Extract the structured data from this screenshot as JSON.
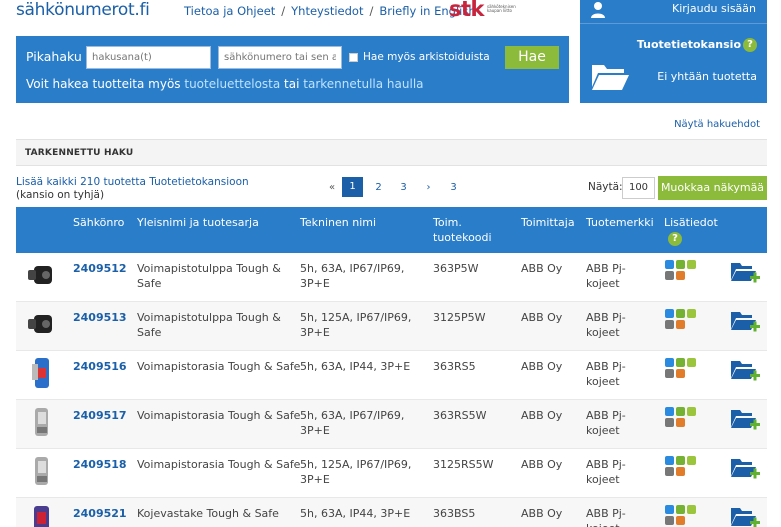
{
  "header": {
    "logo": "sähkönumerot.fi",
    "nav": [
      "Tietoa ja Ohjeet",
      "Yhteystiedot",
      "Briefly in English"
    ],
    "nav_sep": "/",
    "stk_logo": "stk",
    "stk_sub": "sähköteknisen kaupan liitto"
  },
  "search": {
    "label": "Pikahaku",
    "keyword_placeholder": "hakusana(t)",
    "number_placeholder": "sähkönumero tai sen alku",
    "archive_label": "Hae myös arkistoiduista",
    "button": "Hae",
    "hint_prefix": "Voit hakea tuotteita myös",
    "hint_link1": "tuoteluettelosta",
    "hint_middle": "tai",
    "hint_link2": "tarkennetulla haulla"
  },
  "account": {
    "login": "Kirjaudu sisään",
    "folder_title": "Tuotetietokansio",
    "help": "?",
    "folder_empty": "Ei yhtään tuotetta"
  },
  "show_conditions": "Näytä hakuehdot",
  "advanced_search_title": "TARKENNETTU HAKU",
  "add_all": "Lisää kaikki 210 tuotetta Tuotetietokansioon",
  "folder_status": "(kansio on tyhjä)",
  "pagination": {
    "first": "«",
    "prev": "‹",
    "pages": [
      "1",
      "2",
      "3"
    ],
    "next": "›",
    "last": "3",
    "active": "1"
  },
  "display": {
    "label": "Näytä:",
    "value": "100",
    "edit_button": "Muokkaa näkymää"
  },
  "table": {
    "headers": {
      "number": "Sähkönro",
      "name": "Yleisnimi ja tuotesarja",
      "tech": "Tekninen nimi",
      "code_line1": "Toim.",
      "code_line2": "tuotekoodi",
      "supplier": "Toimittaja",
      "brand": "Tuotemerkki",
      "info": "Lisätiedot",
      "help": "?"
    },
    "rows": [
      {
        "number": "2409512",
        "name1": "Voimapistotulppa Tough &",
        "name2": "Safe",
        "tech1": "5h, 63A, IP67/IP69,",
        "tech2": "3P+E",
        "code": "363P5W",
        "supplier": "ABB Oy",
        "brand1": "ABB Pj-",
        "brand2": "kojeet",
        "thumb": "plug-black"
      },
      {
        "number": "2409513",
        "name1": "Voimapistotulppa Tough &",
        "name2": "Safe",
        "tech1": "5h, 125A, IP67/IP69,",
        "tech2": "3P+E",
        "code": "3125P5W",
        "supplier": "ABB Oy",
        "brand1": "ABB Pj-",
        "brand2": "kojeet",
        "thumb": "plug-black"
      },
      {
        "number": "2409516",
        "name1": "Voimapistorasia Tough & Safe",
        "name2": "",
        "tech1": "5h, 63A, IP44, 3P+E",
        "tech2": "",
        "code": "363RS5",
        "supplier": "ABB Oy",
        "brand1": "ABB Pj-",
        "brand2": "kojeet",
        "thumb": "socket-blue"
      },
      {
        "number": "2409517",
        "name1": "Voimapistorasia Tough & Safe",
        "name2": "",
        "tech1": "5h, 63A, IP67/IP69,",
        "tech2": "3P+E",
        "code": "363RS5W",
        "supplier": "ABB Oy",
        "brand1": "ABB Pj-",
        "brand2": "kojeet",
        "thumb": "socket-gray"
      },
      {
        "number": "2409518",
        "name1": "Voimapistorasia Tough & Safe",
        "name2": "",
        "tech1": "5h, 125A, IP67/IP69,",
        "tech2": "3P+E",
        "code": "3125RS5W",
        "supplier": "ABB Oy",
        "brand1": "ABB Pj-",
        "brand2": "kojeet",
        "thumb": "socket-gray"
      },
      {
        "number": "2409521",
        "name1": "Kojevastake Tough & Safe",
        "name2": "",
        "tech1": "5h, 63A, IP44, 3P+E",
        "tech2": "",
        "code": "363BS5",
        "supplier": "ABB Oy",
        "brand1": "ABB Pj-",
        "brand2": "kojeet",
        "thumb": "inlet-purple"
      }
    ]
  },
  "colors": {
    "primary": "#2a7dc9",
    "accent_green": "#8cba3a",
    "link": "#1a5fa8"
  }
}
